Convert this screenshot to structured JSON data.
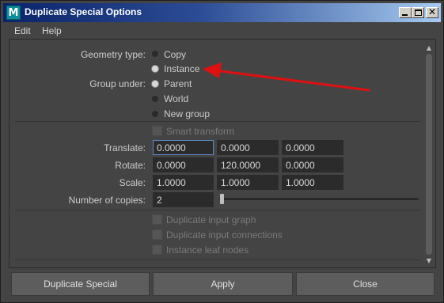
{
  "window": {
    "title": "Duplicate Special Options",
    "app_icon_letter": "M"
  },
  "menubar": {
    "items": [
      "Edit",
      "Help"
    ]
  },
  "geometry": {
    "label": "Geometry type:",
    "options": [
      {
        "label": "Copy",
        "selected": false
      },
      {
        "label": "Instance",
        "selected": true
      }
    ]
  },
  "group": {
    "label": "Group under:",
    "options": [
      {
        "label": "Parent",
        "selected": true
      },
      {
        "label": "World",
        "selected": false
      },
      {
        "label": "New group",
        "selected": false
      }
    ]
  },
  "smart_transform": {
    "label": "Smart transform",
    "checked": false,
    "enabled": false
  },
  "transforms": {
    "translate": {
      "label": "Translate:",
      "values": [
        "0.0000",
        "0.0000",
        "0.0000"
      ]
    },
    "rotate": {
      "label": "Rotate:",
      "values": [
        "0.0000",
        "120.0000",
        "0.0000"
      ]
    },
    "scale": {
      "label": "Scale:",
      "values": [
        "1.0000",
        "1.0000",
        "1.0000"
      ]
    }
  },
  "copies": {
    "label": "Number of copies:",
    "value": "2",
    "slider_fraction": 0.0
  },
  "options": [
    {
      "label": "Duplicate input graph",
      "checked": false,
      "enabled": false
    },
    {
      "label": "Duplicate input connections",
      "checked": false,
      "enabled": false
    },
    {
      "label": "Instance leaf nodes",
      "checked": false,
      "enabled": false
    }
  ],
  "buttons": {
    "duplicate": "Duplicate Special",
    "apply": "Apply",
    "close": "Close"
  },
  "colors": {
    "annotation_arrow": "#e01010",
    "title_gradient_start": "#0a246a",
    "field_focus": "#5a8ac6"
  }
}
